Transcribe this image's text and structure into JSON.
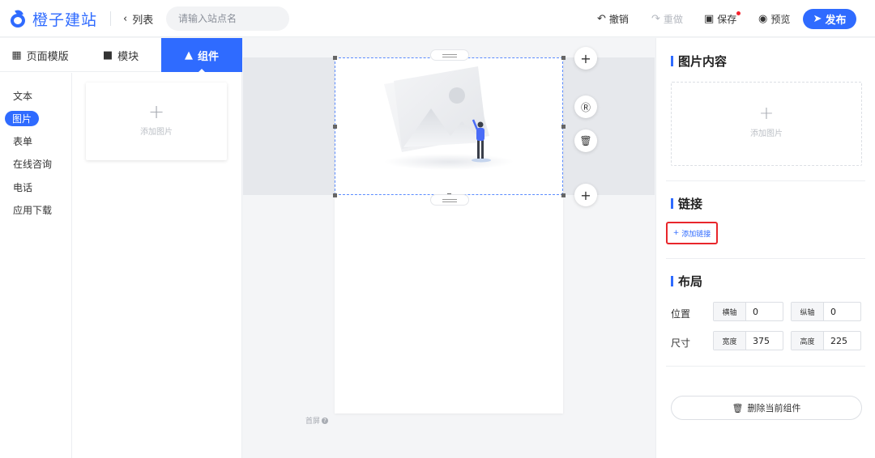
{
  "brand": {
    "name": "橙子建站",
    "color": "#2f6bff"
  },
  "header": {
    "back_label": "列表",
    "search_placeholder": "请输入站点名",
    "undo_label": "撤销",
    "redo_label": "重做",
    "save_label": "保存",
    "preview_label": "预览",
    "publish_label": "发布"
  },
  "left_tabs": [
    {
      "label": "页面模版",
      "icon": "template-icon"
    },
    {
      "label": "模块",
      "icon": "module-icon"
    },
    {
      "label": "组件",
      "icon": "puzzle-icon",
      "active": true
    }
  ],
  "categories": [
    "文本",
    "图片",
    "表单",
    "在线咨询",
    "电话",
    "应用下载"
  ],
  "active_category": "图片",
  "component_card": {
    "label": "添加图片"
  },
  "canvas": {
    "fold_label": "首屏"
  },
  "right_panel": {
    "image_section": {
      "title": "图片内容",
      "upload_label": "添加图片"
    },
    "link_section": {
      "title": "链接",
      "add_link_label": "添加链接"
    },
    "layout_section": {
      "title": "布局",
      "position_label": "位置",
      "size_label": "尺寸",
      "x_label": "横轴",
      "x_value": "0",
      "y_label": "纵轴",
      "y_value": "0",
      "width_label": "宽度",
      "width_value": "375",
      "height_label": "高度",
      "height_value": "225"
    },
    "delete_label": "删除当前组件"
  }
}
